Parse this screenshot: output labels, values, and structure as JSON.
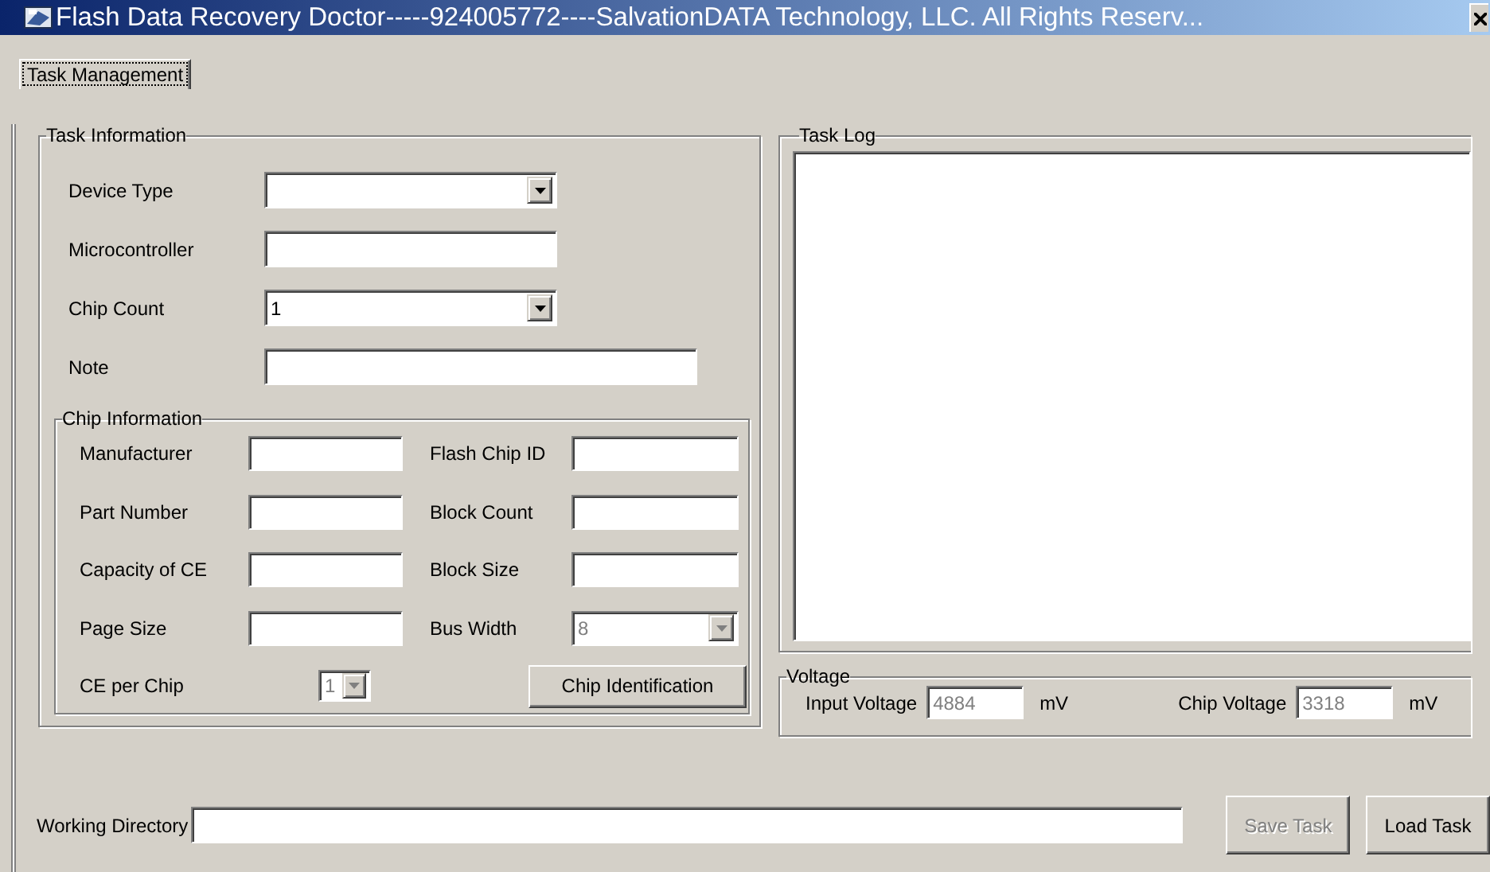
{
  "window": {
    "title": "Flash Data Recovery Doctor-----924005772----SalvationDATA Technology, LLC. All Rights Reserv..."
  },
  "tabs": [
    {
      "label": "Task Management",
      "selected": true
    }
  ],
  "task_information": {
    "title": "Task Information",
    "fields": [
      {
        "kind": "combo",
        "label": "Device Type"
      },
      {
        "kind": "text",
        "label": "Microcontroller"
      },
      {
        "kind": "combo",
        "label": "Chip Count",
        "value": "1"
      },
      {
        "kind": "text",
        "label": "Note"
      }
    ]
  },
  "chip_information": {
    "title": "Chip Information",
    "fields": [
      {
        "kind": "text",
        "label": "Manufacturer"
      },
      {
        "kind": "text",
        "label": "Flash Chip ID"
      },
      {
        "kind": "text",
        "label": "Part Number"
      },
      {
        "kind": "text",
        "label": "Block Count"
      },
      {
        "kind": "text",
        "label": "Capacity of CE"
      },
      {
        "kind": "text",
        "label": "Block Size"
      },
      {
        "kind": "text",
        "label": "Page Size"
      },
      {
        "kind": "combo",
        "label": "Bus Width",
        "value": "8",
        "disabled": true
      },
      {
        "kind": "combo",
        "label": "CE per Chip",
        "value": "1",
        "disabled": true
      }
    ],
    "button": {
      "label": "Chip Identification"
    }
  },
  "task_log": {
    "title": "Task Log"
  },
  "voltage": {
    "title": "Voltage",
    "readings": [
      {
        "label": "Input Voltage",
        "value": "4884",
        "unit": "mV",
        "disabled": true
      },
      {
        "label": "Chip Voltage",
        "value": "3318",
        "unit": "mV",
        "disabled": true
      }
    ]
  },
  "working_directory": {
    "label": "Working Directory"
  },
  "buttons": [
    {
      "label": "Save Task",
      "disabled": true
    },
    {
      "label": "Load Task",
      "disabled": false
    }
  ]
}
